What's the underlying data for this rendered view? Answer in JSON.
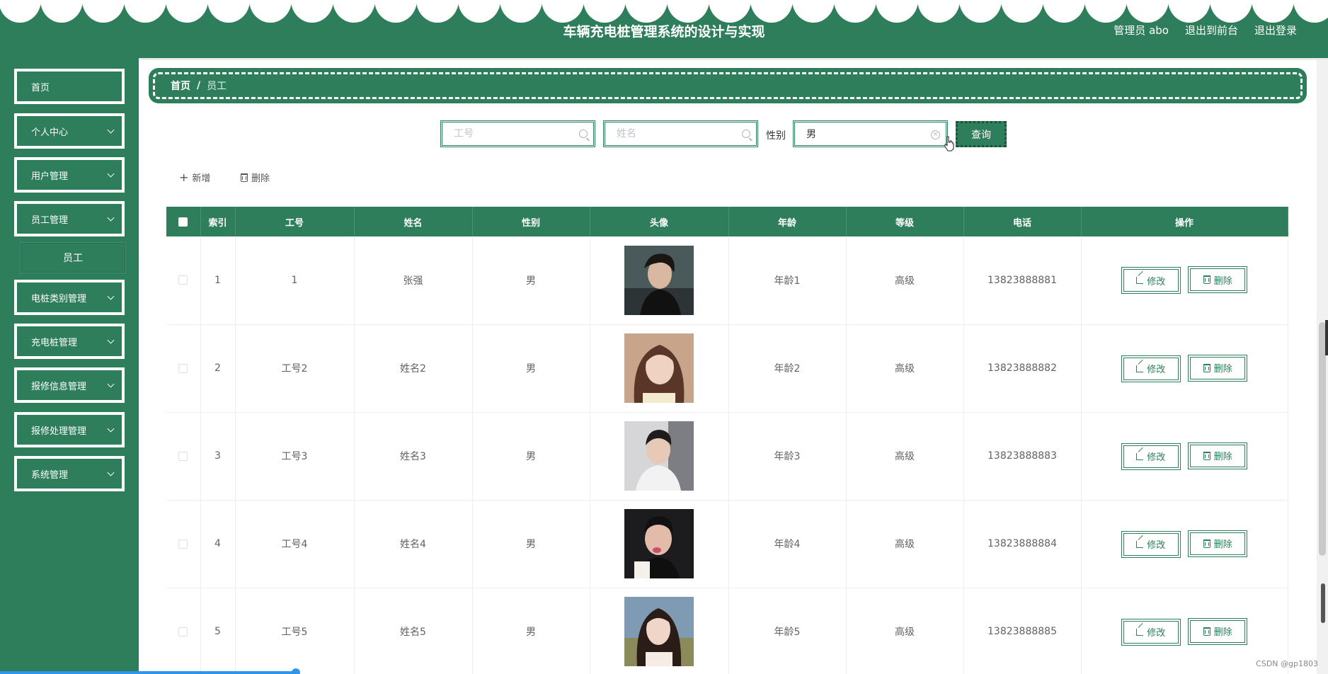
{
  "header": {
    "title": "车辆充电桩管理系统的设计与实现",
    "links": [
      "管理员 abo",
      "退出到前台",
      "退出登录"
    ]
  },
  "sidebar": {
    "items": [
      {
        "label": "首页",
        "expandable": false
      },
      {
        "label": "个人中心",
        "expandable": true
      },
      {
        "label": "用户管理",
        "expandable": true
      },
      {
        "label": "员工管理",
        "expandable": true
      },
      {
        "label": "电桩类别管理",
        "expandable": true
      },
      {
        "label": "充电桩管理",
        "expandable": true
      },
      {
        "label": "报修信息管理",
        "expandable": true
      },
      {
        "label": "报修处理管理",
        "expandable": true
      },
      {
        "label": "系统管理",
        "expandable": true
      }
    ],
    "submenu": {
      "label": "员工"
    }
  },
  "breadcrumb": {
    "home": "首页",
    "separator": "/",
    "current": "员工"
  },
  "search": {
    "staff_no_placeholder": "工号",
    "name_placeholder": "姓名",
    "gender_label": "性别",
    "gender_value": "男",
    "query_label": "查询"
  },
  "actions": {
    "add_label": "新增",
    "delete_label": "删除"
  },
  "table": {
    "columns": [
      "索引",
      "工号",
      "姓名",
      "性别",
      "头像",
      "年龄",
      "等级",
      "电话",
      "操作"
    ],
    "edit_label": "修改",
    "delete_label": "删除",
    "rows": [
      {
        "index": "1",
        "staff_no": "1",
        "name": "张强",
        "gender": "男",
        "age": "年龄1",
        "level": "高级",
        "phone": "13823888881"
      },
      {
        "index": "2",
        "staff_no": "工号2",
        "name": "姓名2",
        "gender": "男",
        "age": "年龄2",
        "level": "高级",
        "phone": "13823888882"
      },
      {
        "index": "3",
        "staff_no": "工号3",
        "name": "姓名3",
        "gender": "男",
        "age": "年龄3",
        "level": "高级",
        "phone": "13823888883"
      },
      {
        "index": "4",
        "staff_no": "工号4",
        "name": "姓名4",
        "gender": "男",
        "age": "年龄4",
        "level": "高级",
        "phone": "13823888884"
      },
      {
        "index": "5",
        "staff_no": "工号5",
        "name": "姓名5",
        "gender": "男",
        "age": "年龄5",
        "level": "高级",
        "phone": "13823888885"
      }
    ]
  },
  "watermark": "CSDN @gp1803",
  "colors": {
    "primary": "#2e7d5b",
    "border": "#ebeef5",
    "text": "#606266"
  }
}
